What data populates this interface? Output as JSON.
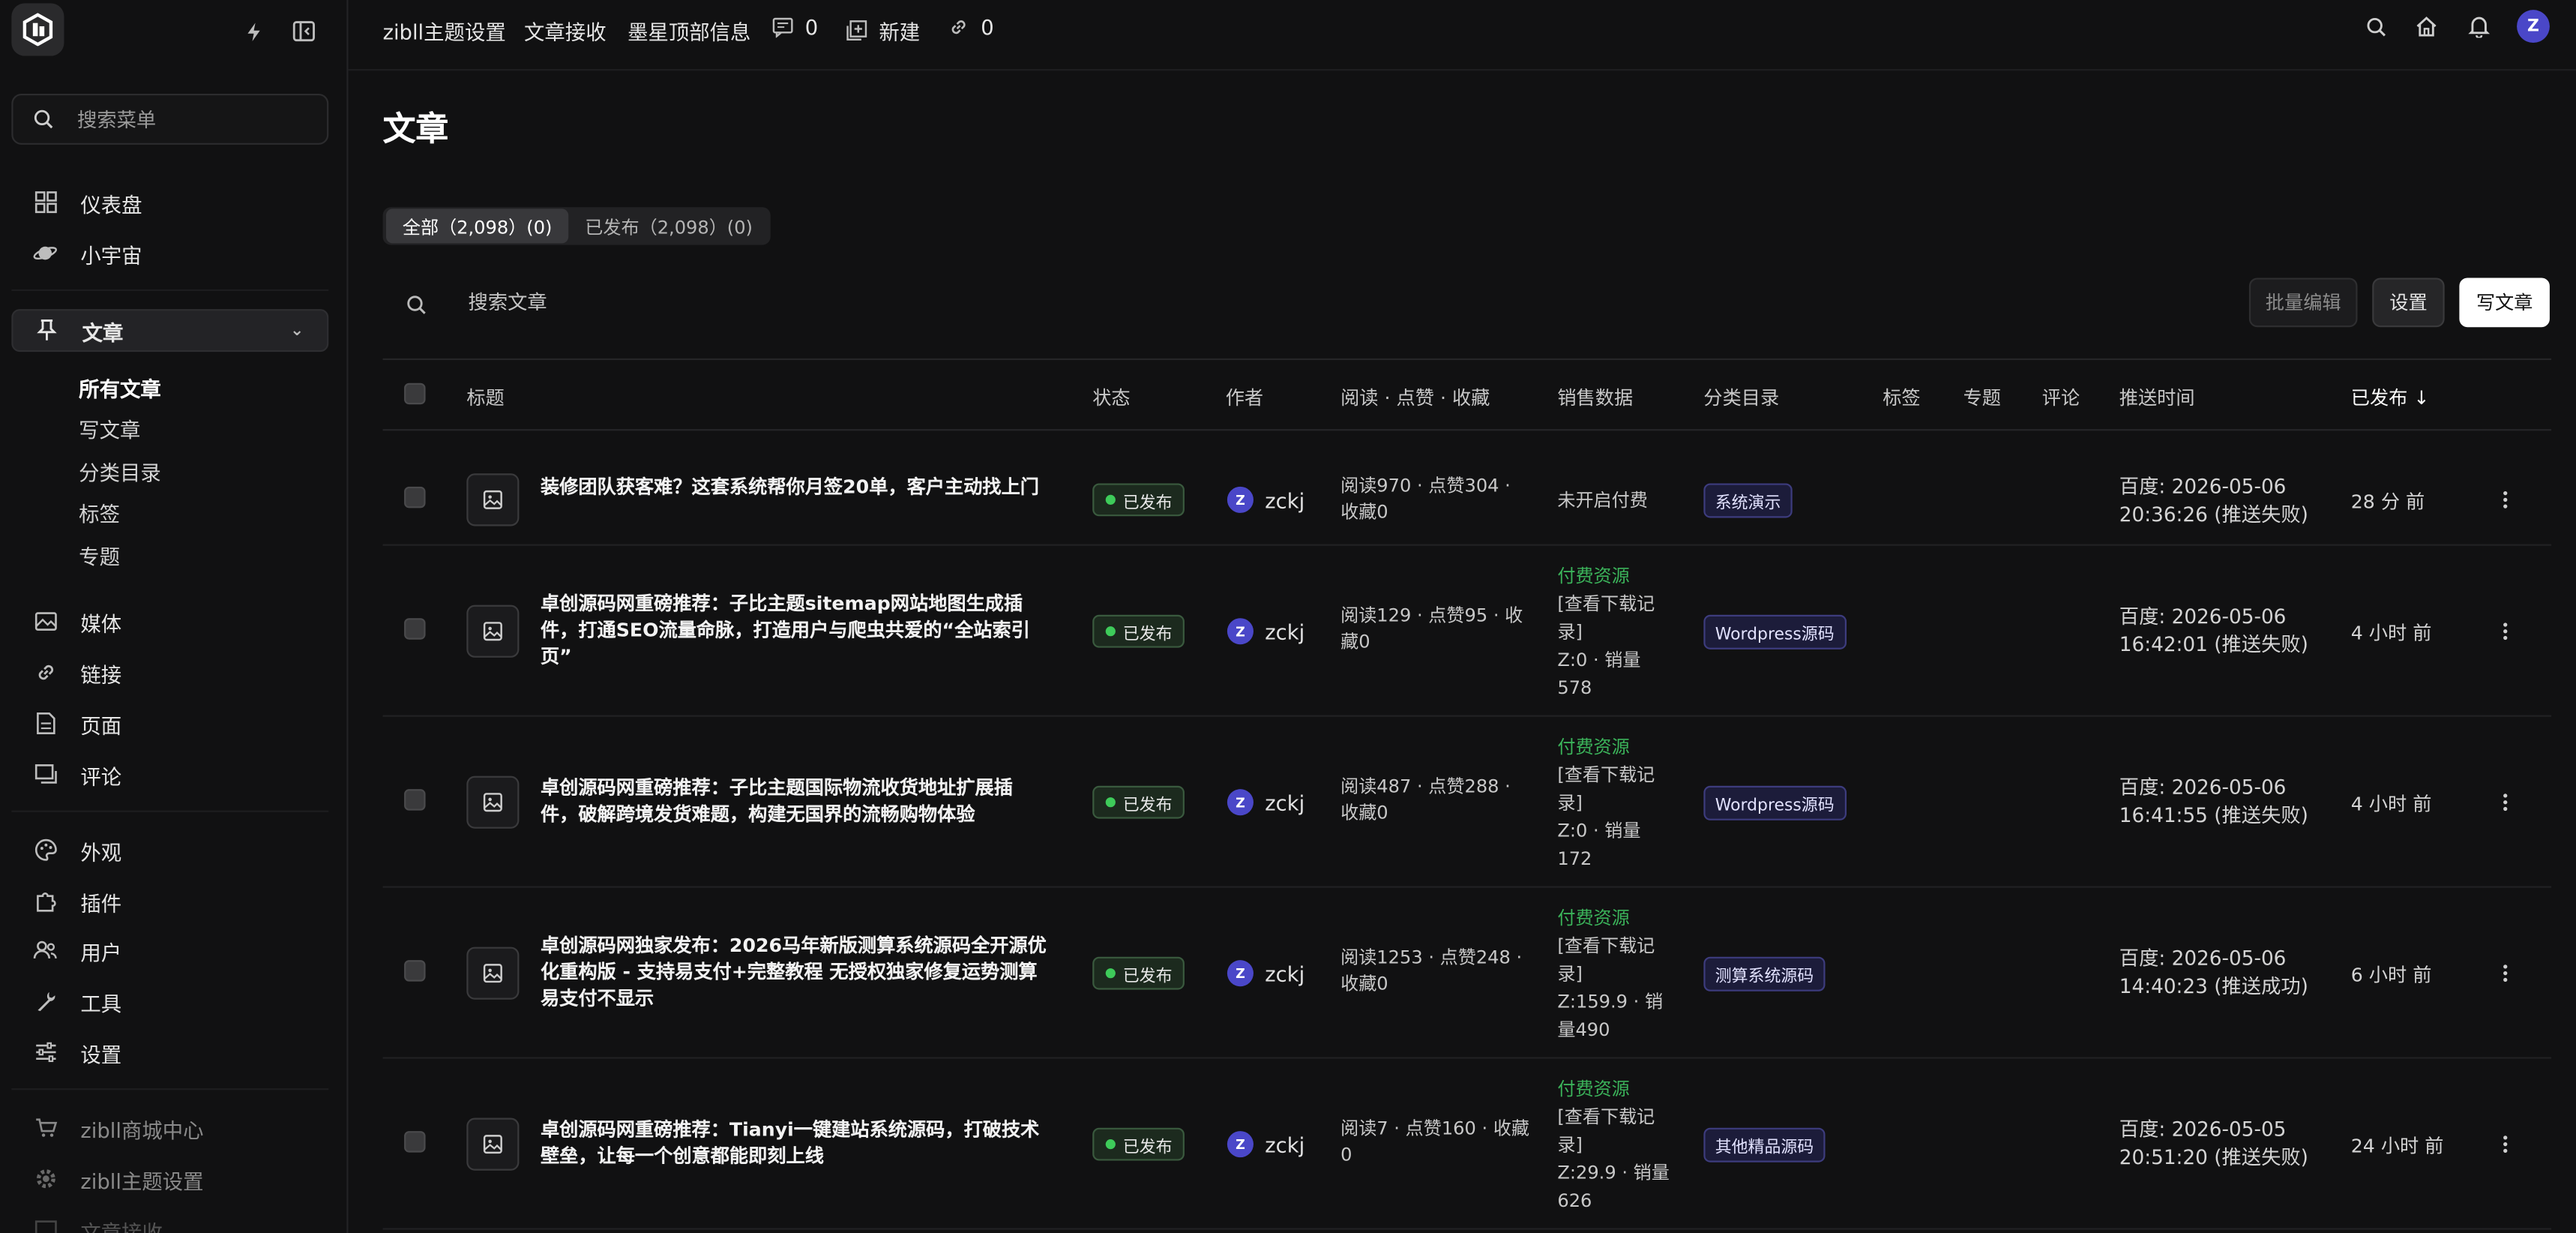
{
  "sidebar": {
    "search_placeholder": "搜索菜单",
    "items": [
      {
        "label": "仪表盘"
      },
      {
        "label": "小宇宙"
      },
      {
        "label": "文章"
      },
      {
        "label": "媒体"
      },
      {
        "label": "链接"
      },
      {
        "label": "页面"
      },
      {
        "label": "评论"
      },
      {
        "label": "外观"
      },
      {
        "label": "插件"
      },
      {
        "label": "用户"
      },
      {
        "label": "工具"
      },
      {
        "label": "设置"
      },
      {
        "label": "zibll商城中心"
      },
      {
        "label": "zibll主题设置"
      },
      {
        "label": "文章接收"
      }
    ],
    "sub_items": [
      {
        "label": "所有文章"
      },
      {
        "label": "写文章"
      },
      {
        "label": "分类目录"
      },
      {
        "label": "标签"
      },
      {
        "label": "专题"
      }
    ]
  },
  "topbar": {
    "theme_settings": "zibll主题设置",
    "article_receive": "文章接收",
    "top_info": "墨星顶部信息",
    "comments_count": "0",
    "new_label": "新建",
    "links_count": "0",
    "avatar_letter": "Z"
  },
  "page": {
    "title": "文章",
    "tabs": [
      {
        "label": "全部（2,098）(0)"
      },
      {
        "label": "已发布（2,098）(0)"
      }
    ],
    "search_placeholder": "搜索文章",
    "batch_edit": "批量编辑",
    "settings": "设置",
    "write": "写文章"
  },
  "table": {
    "headers": {
      "title": "标题",
      "status": "状态",
      "author": "作者",
      "stats": "阅读 · 点赞 · 收藏",
      "sales": "销售数据",
      "category": "分类目录",
      "tags": "标签",
      "topics": "专题",
      "comments": "评论",
      "push_time": "推送时间",
      "published": "已发布 ↓"
    },
    "rows": [
      {
        "title": "装修团队获客难？这套系统帮你月签20单，客户主动找上门",
        "status": "已发布",
        "author_initial": "Z",
        "author": "zckj",
        "stats": "阅读970 · 点赞304 · 收藏0",
        "sales_paid": "",
        "sales_text": "未开启付费",
        "category": "系统演示",
        "push": "百度: 2026-05-06 20:36:26 (推送失败)",
        "published": "28 分 前"
      },
      {
        "title": "卓创源码网重磅推荐：子比主题sitemap网站地图生成插件，打通SEO流量命脉，打造用户与爬虫共爱的“全站索引页”",
        "status": "已发布",
        "author_initial": "Z",
        "author": "zckj",
        "stats": "阅读129 · 点赞95 · 收藏0",
        "sales_paid": "付费资源",
        "sales_text": "[查看下载记录]\nZ:0 · 销量578",
        "category": "Wordpress源码",
        "push": "百度: 2026-05-06 16:42:01 (推送失败)",
        "published": "4 小时 前"
      },
      {
        "title": "卓创源码网重磅推荐：子比主题国际物流收货地址扩展插件，破解跨境发货难题，构建无国界的流畅购物体验",
        "status": "已发布",
        "author_initial": "Z",
        "author": "zckj",
        "stats": "阅读487 · 点赞288 · 收藏0",
        "sales_paid": "付费资源",
        "sales_text": "[查看下载记录]\nZ:0 · 销量172",
        "category": "Wordpress源码",
        "push": "百度: 2026-05-06 16:41:55 (推送失败)",
        "published": "4 小时 前"
      },
      {
        "title": "卓创源码网独家发布：2026马年新版测算系统源码全开源优化重构版 - 支持易支付+完整教程 无授权独家修复运势测算易支付不显示",
        "status": "已发布",
        "author_initial": "Z",
        "author": "zckj",
        "stats": "阅读1253 · 点赞248 · 收藏0",
        "sales_paid": "付费资源",
        "sales_text": "[查看下载记录]\nZ:159.9 · 销量490",
        "category": "测算系统源码",
        "push": "百度: 2026-05-06 14:40:23 (推送成功)",
        "published": "6 小时 前"
      },
      {
        "title": "卓创源码网重磅推荐：Tianyi一键建站系统源码，打破技术壁垒，让每一个创意都能即刻上线",
        "status": "已发布",
        "author_initial": "Z",
        "author": "zckj",
        "stats": "阅读7 · 点赞160 · 收藏0",
        "sales_paid": "付费资源",
        "sales_text": "[查看下载记录]\nZ:29.9 · 销量626",
        "category": "其他精品源码",
        "push": "百度: 2026-05-05 20:51:20 (推送失败)",
        "published": "24 小时 前"
      }
    ]
  },
  "colors": {
    "background": "#111112",
    "accent": "#4a47c8",
    "published_green": "#3ecb5a",
    "paid_green": "#3bb35a"
  }
}
